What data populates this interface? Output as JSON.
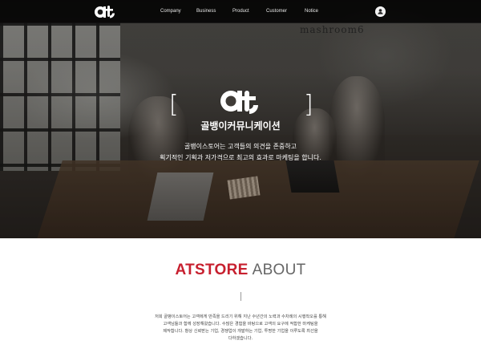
{
  "nav": {
    "logo_text": "at",
    "items": [
      {
        "label": "Company"
      },
      {
        "label": "Business"
      },
      {
        "label": "Product"
      },
      {
        "label": "Customer"
      },
      {
        "label": "Notice"
      }
    ],
    "user_icon": "user-icon"
  },
  "hero": {
    "wall_sign": "mashroom6",
    "logo_text": "at",
    "title": "골뱅이커뮤니케이션",
    "desc_line1": "골뱅이스토어는 고객들의 의견을 존중하고",
    "desc_line2": "획기적인 기획과 저가격으로 최고의 효과로 마케팅을 합니다."
  },
  "about": {
    "title_strong": "ATSTORE",
    "title_light": "ABOUT",
    "text_line1": "저희 골뱅이스토어는 고객에게 만족을 드리기 위해 지난 수년간의 노력과 수차례의 시행착오를 통해",
    "text_line2": "고객님들과 함께 성장해왔습니다. 수많은 경험을 바탕으로 고객의 요구에 적합한 마케팅을",
    "text_line3": "제작합니다. 항상 신뢰받는 기업, 경쟁업이 개발하는 기업, 투명한 기업을 이루도록 최선을",
    "text_line4": "다하겠습니다."
  },
  "colors": {
    "accent": "#c7202f",
    "nav_bg": "#000000",
    "text_gray": "#666666"
  }
}
